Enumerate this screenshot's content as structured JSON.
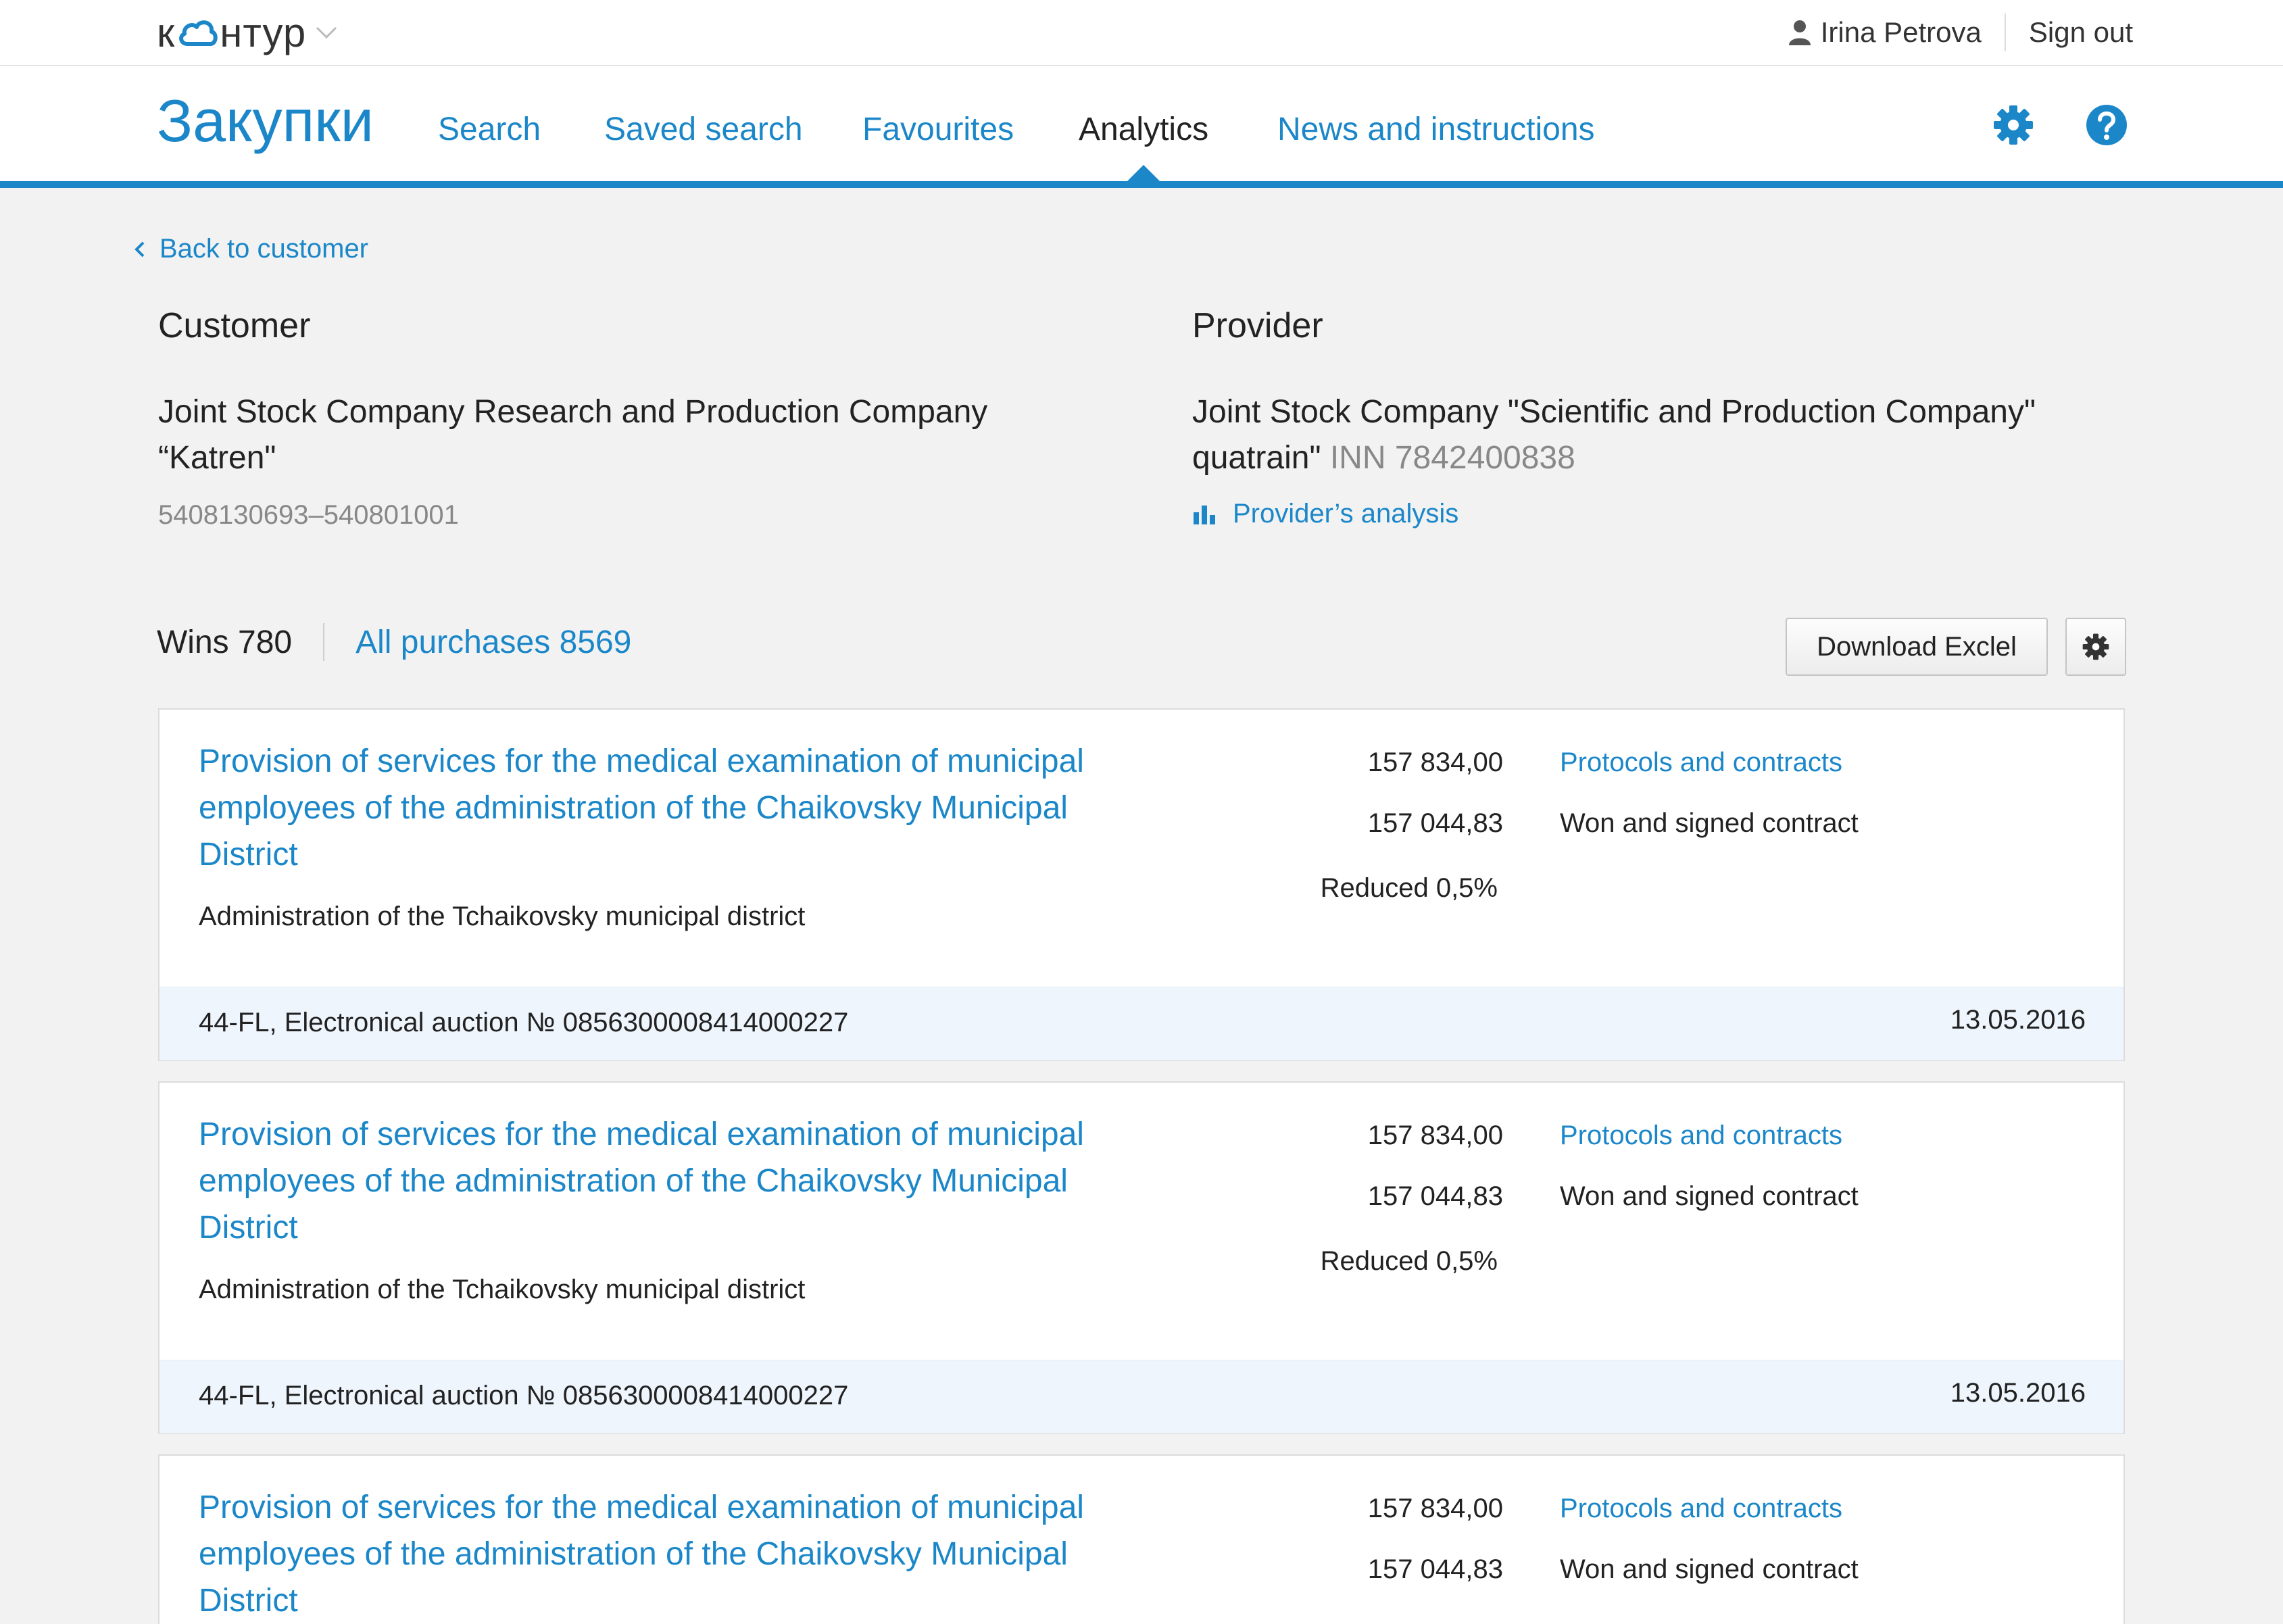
{
  "header": {
    "logo": "контур",
    "user_name": "Irina Petrova",
    "sign_out": "Sign out"
  },
  "nav": {
    "brand": "Закупки",
    "items": [
      {
        "label": "Search"
      },
      {
        "label": "Saved search"
      },
      {
        "label": "Favourites"
      },
      {
        "label": "Analytics",
        "active": true
      },
      {
        "label": "News and instructions"
      }
    ]
  },
  "back_link": "Back to customer",
  "customer": {
    "title": "Customer",
    "name": "Joint Stock Company Research and Production Company “Katren\"",
    "ids": "5408130693–540801001"
  },
  "provider": {
    "title": "Provider",
    "name": "Joint Stock Company \"Scientific and Production Company\" quatrain\"",
    "inn": "INN 7842400838",
    "analysis_link": "Provider’s analysis"
  },
  "summary": {
    "wins": "Wins 780",
    "all_purchases": "All purchases 8569",
    "download_button": "Download Exclel"
  },
  "purchases": [
    {
      "title": "Provision of services for the medical examination of municipal employees of the administration of the Chaikovsky Municipal District",
      "organization": "Administration of the Tchaikovsky municipal district",
      "initial_price": "157 834,00",
      "final_price": "157 044,83",
      "reduction": "Reduced 0,5%",
      "docs_link": "Protocols and contracts",
      "status": "Won and signed contract",
      "procedure": "44-FL, Electronical auction № 0856300008414000227",
      "date": "13.05.2016"
    },
    {
      "title": "Provision of services for the medical examination of municipal employees of the administration of the Chaikovsky Municipal District",
      "organization": "Administration of the Tchaikovsky municipal district",
      "initial_price": "157 834,00",
      "final_price": "157 044,83",
      "reduction": "Reduced 0,5%",
      "docs_link": "Protocols and contracts",
      "status": "Won and signed contract",
      "procedure": "44-FL, Electronical auction № 0856300008414000227",
      "date": "13.05.2016"
    },
    {
      "title": "Provision of services for the medical examination of municipal employees of the administration of the Chaikovsky Municipal District",
      "organization": "",
      "initial_price": "157 834,00",
      "final_price": "157 044,83",
      "reduction": "",
      "docs_link": "Protocols and contracts",
      "status": "Won and signed contract",
      "procedure": "",
      "date": ""
    }
  ]
}
